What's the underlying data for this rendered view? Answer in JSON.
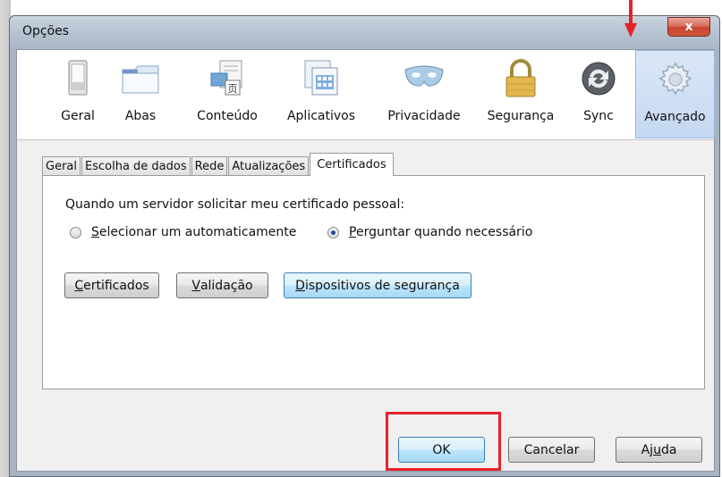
{
  "window": {
    "title": "Opções",
    "close_label": "x"
  },
  "toolbar": {
    "panes": [
      {
        "label": "Geral",
        "icon": "general-switch-icon"
      },
      {
        "label": "Abas",
        "icon": "tabs-icon"
      },
      {
        "label": "Conteúdo",
        "icon": "content-icon"
      },
      {
        "label": "Aplicativos",
        "icon": "applications-icon"
      },
      {
        "label": "Privacidade",
        "icon": "privacy-mask-icon"
      },
      {
        "label": "Segurança",
        "icon": "security-lock-icon"
      },
      {
        "label": "Sync",
        "icon": "sync-icon"
      },
      {
        "label": "Avançado",
        "icon": "advanced-gear-icon"
      }
    ],
    "active_pane": "Avançado"
  },
  "tabs": {
    "items": [
      "Geral",
      "Escolha de dados",
      "Rede",
      "Atualizações",
      "Certificados"
    ],
    "active": "Certificados"
  },
  "certificates": {
    "question": "Quando um servidor solicitar meu certificado pessoal:",
    "option_auto": {
      "accel": "S",
      "rest": "elecionar um automaticamente",
      "checked": false
    },
    "option_ask": {
      "accel": "P",
      "rest": "erguntar quando necessário",
      "checked": true
    },
    "btn_certificates": {
      "accel": "C",
      "rest": "ertificados"
    },
    "btn_validation": {
      "accel": "V",
      "rest": "alidação"
    },
    "btn_devices": {
      "accel": "D",
      "rest": "ispositivos de segurança"
    }
  },
  "footer": {
    "ok_label": "OK",
    "cancel_label": "Cancelar",
    "help_pre": "Aj",
    "help_accel": "u",
    "help_post": "da"
  },
  "annotations": {
    "highlight_color": "#e8222a"
  }
}
